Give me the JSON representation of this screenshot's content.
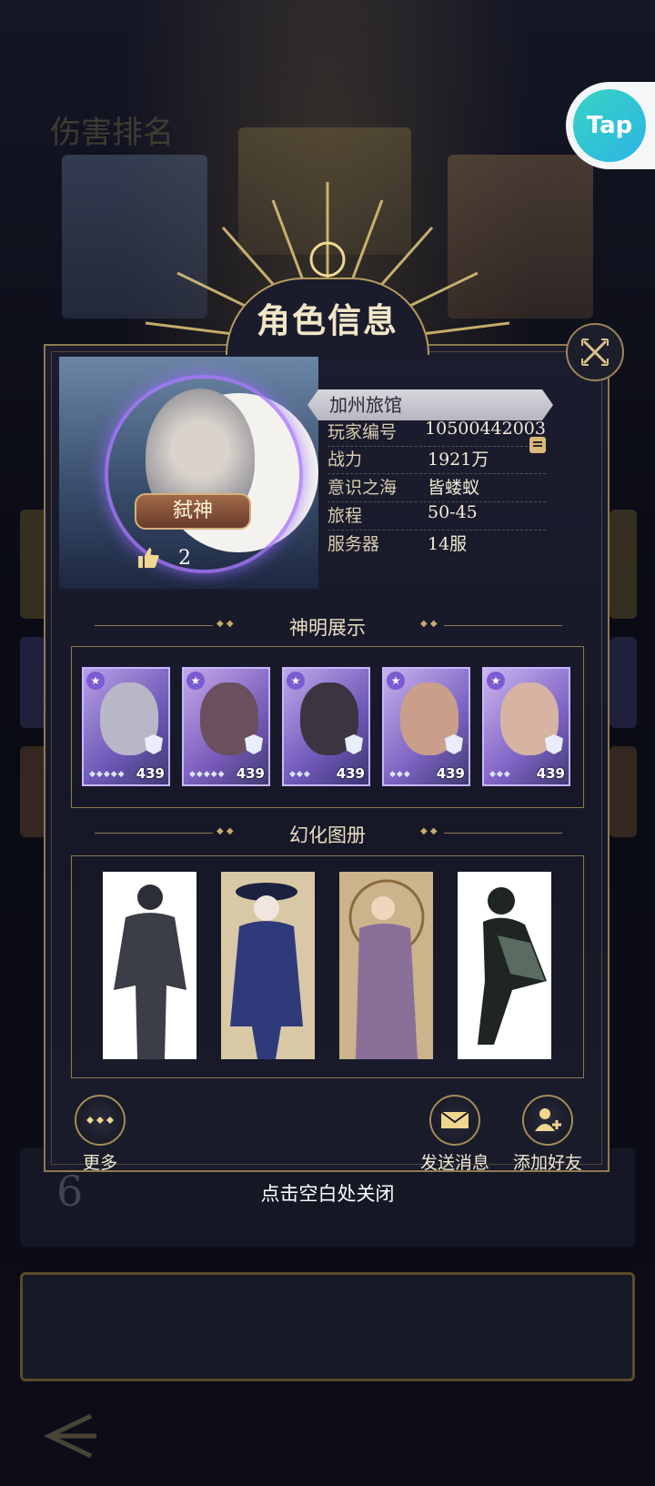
{
  "overlay": {
    "title": "角色信息",
    "close_hint": "点击空白处关闭"
  },
  "tap_badge": {
    "label": "Tap"
  },
  "profile": {
    "name": "加州旅馆",
    "rank_label": "弑神",
    "likes": "2",
    "fields": [
      {
        "key": "玩家编号",
        "value": "10500442003"
      },
      {
        "key": "战力",
        "value": "1921万"
      },
      {
        "key": "意识之海",
        "value": "皆蝼蚁"
      },
      {
        "key": "旅程",
        "value": "50-45"
      },
      {
        "key": "服务器",
        "value": "14服"
      }
    ]
  },
  "gods_section": {
    "title": "神明展示",
    "cards": [
      {
        "level": "439",
        "pips": "◆◆◆◆◆",
        "color": "#b9b6c8"
      },
      {
        "level": "439",
        "pips": "◆◆◆◆◆",
        "color": "#6a4f5e"
      },
      {
        "level": "439",
        "pips": "◆◆◆",
        "color": "#3a3540"
      },
      {
        "level": "439",
        "pips": "◆◆◆",
        "color": "#c99f8c"
      },
      {
        "level": "439",
        "pips": "◆◆◆",
        "color": "#d6b3a3"
      }
    ]
  },
  "album_section": {
    "title": "幻化图册",
    "cards": [
      {
        "color": "#3b3e46",
        "bg": "#ffffff"
      },
      {
        "color": "#2f3a7a",
        "bg": "#d9c8a6"
      },
      {
        "color": "#8a6f99",
        "bg": "#cbb38c"
      },
      {
        "color": "#1e2522",
        "bg": "#ffffff"
      }
    ]
  },
  "actions": {
    "more": "更多",
    "send_message": "发送消息",
    "add_friend": "添加好友"
  },
  "background": {
    "title": "伤害排名",
    "rank_number": "6"
  }
}
